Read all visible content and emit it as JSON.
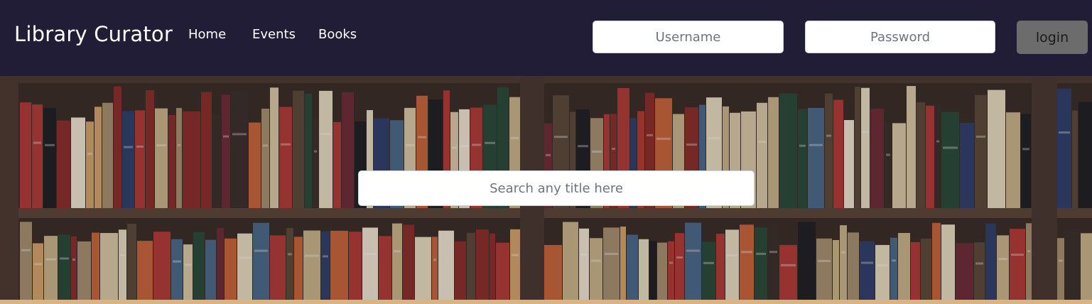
{
  "app": {
    "title": "Library Curator"
  },
  "nav": {
    "items": [
      {
        "label": "Home"
      },
      {
        "label": "Events"
      },
      {
        "label": "Books"
      }
    ]
  },
  "auth": {
    "username_placeholder": "Username",
    "password_placeholder": "Password",
    "login_label": "login"
  },
  "search": {
    "placeholder": "Search any title here"
  },
  "hero": {
    "description_icon": "bookshelf-photo"
  },
  "colors": {
    "navbar": "#211d36",
    "brand_text": "#ffffff",
    "login_button": "#6c6c6c",
    "page_bottom": "#d7b386"
  }
}
